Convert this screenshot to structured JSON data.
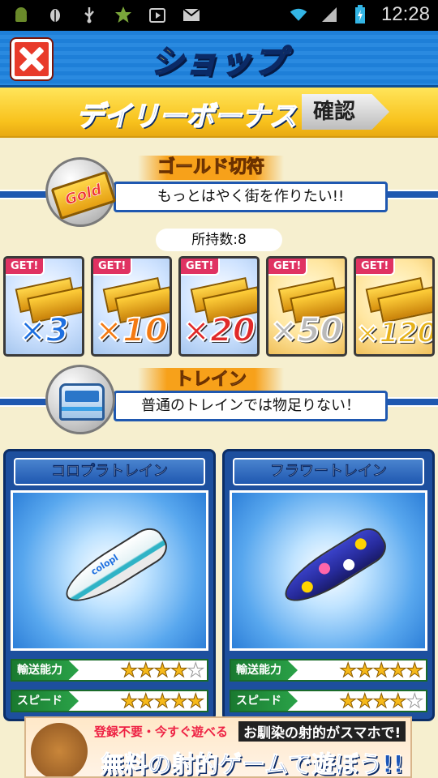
{
  "status_bar": {
    "time": "12:28"
  },
  "header": {
    "title": "ショップ"
  },
  "bonus": {
    "label": "デイリーボーナス",
    "confirm_label": "確認"
  },
  "gold_section": {
    "title": "ゴールド切符",
    "message": "もっとはやく街を作りたい!!",
    "icon_text": "Gold",
    "holding": "所持数:8",
    "packs": [
      {
        "tag": "GET!",
        "multiplier": "×3",
        "color": "#1d6fe0"
      },
      {
        "tag": "GET!",
        "multiplier": "×10",
        "color": "#f47a12"
      },
      {
        "tag": "GET!",
        "multiplier": "×20",
        "color": "#e02a2a"
      },
      {
        "tag": "GET!",
        "multiplier": "×50",
        "color": "#b9b9b9"
      },
      {
        "tag": "GET!",
        "multiplier": "×120",
        "color": "#e6b21a"
      }
    ]
  },
  "train_section": {
    "title": "トレイン",
    "message": "普通のトレインでは物足りない！"
  },
  "trains": [
    {
      "name": "コロプラトレイン",
      "logo": "colopl",
      "stats": [
        {
          "label": "輸送能力",
          "rating": 4
        },
        {
          "label": "スピード",
          "rating": 5
        }
      ]
    },
    {
      "name": "フラワートレイン",
      "stats": [
        {
          "label": "輸送能力",
          "rating": 5
        },
        {
          "label": "スピード",
          "rating": 4
        }
      ]
    }
  ],
  "ad": {
    "line1": "登録不要・今すぐ遊べる",
    "line1b": "お馴染の射的がスマホで!",
    "line2": "無料の射的ゲームで遊ぼう!!"
  }
}
